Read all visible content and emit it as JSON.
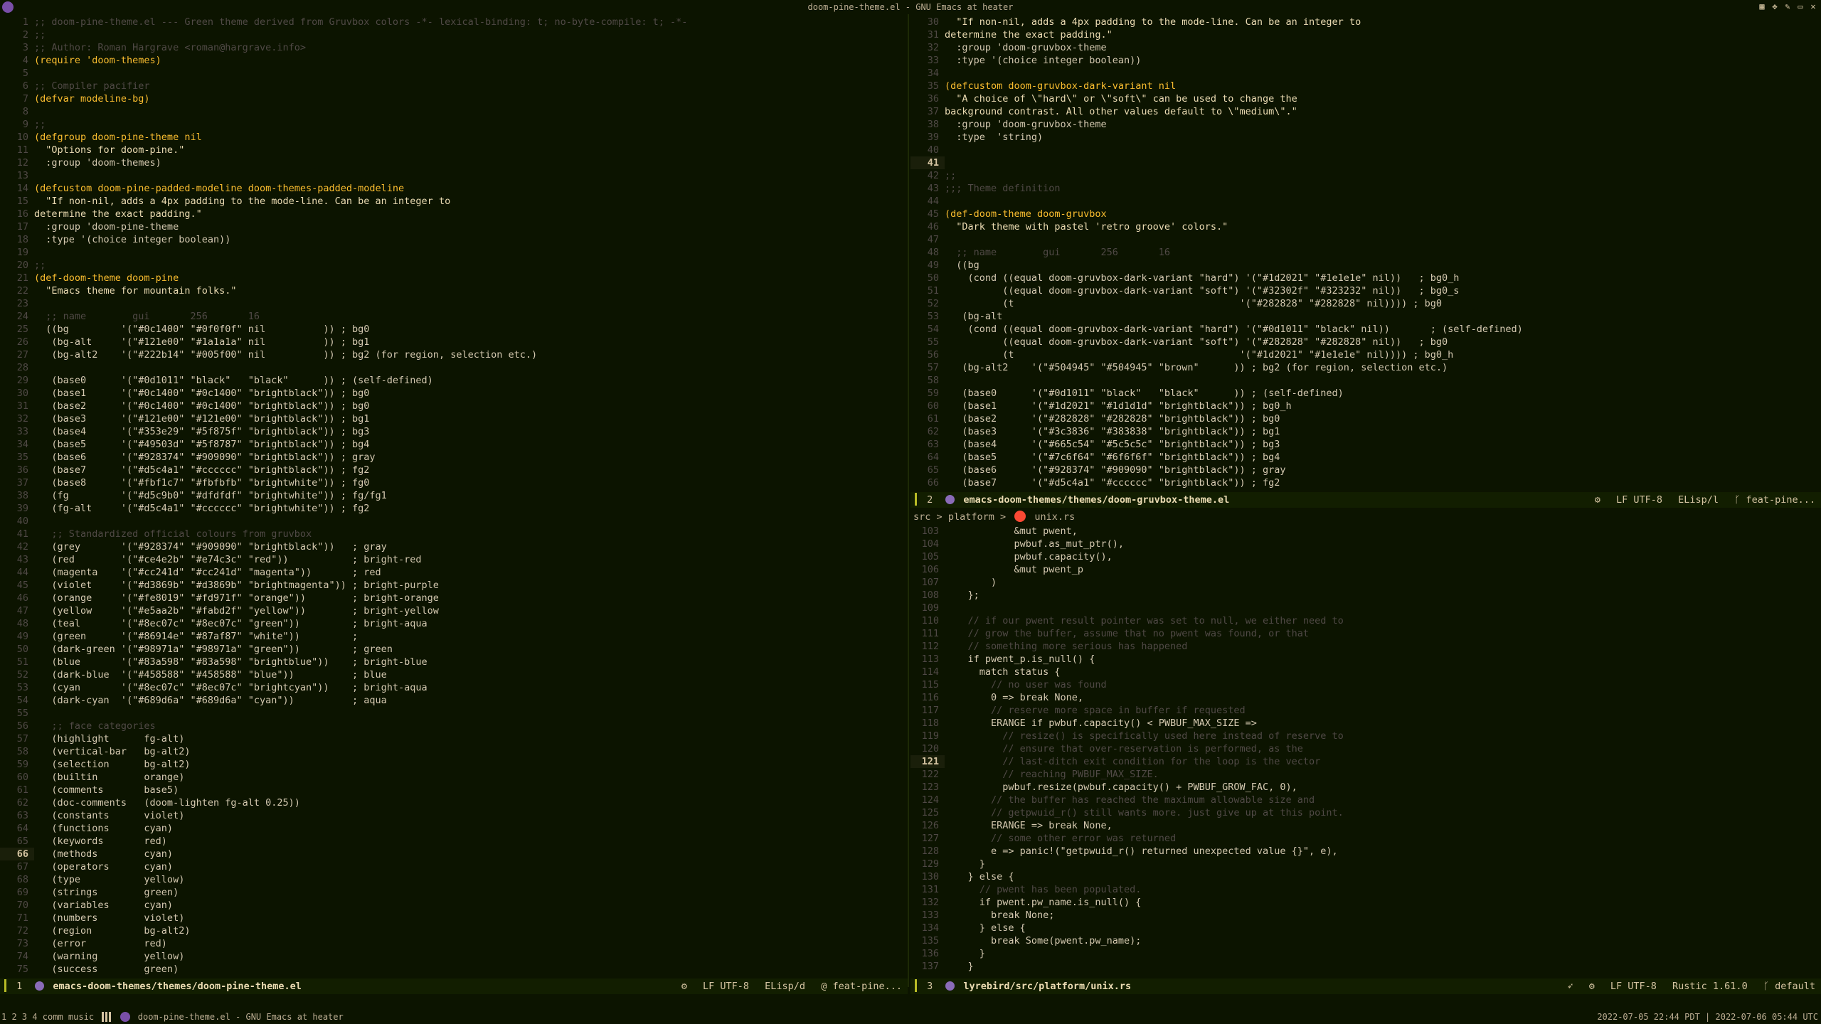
{
  "window": {
    "title": "doom-pine-theme.el - GNU Emacs at heater",
    "icons": [
      "emacs-icon",
      "tile-icon",
      "move-icon",
      "pin-icon",
      "maximize-icon",
      "close-icon"
    ]
  },
  "pane_left": {
    "lines": [
      {
        "n": "1",
        "t": ";; doom-pine-theme.el --- Green theme derived from Gruvbox colors -*- lexical-binding: t; no-byte-compile: t; -*-"
      },
      {
        "n": "2",
        "t": ";;"
      },
      {
        "n": "3",
        "t": ";; Author: Roman Hargrave <roman@hargrave.info>"
      },
      {
        "n": "4",
        "t": "(require 'doom-themes)"
      },
      {
        "n": "5",
        "t": ""
      },
      {
        "n": "6",
        "t": ";; Compiler pacifier"
      },
      {
        "n": "7",
        "t": "(defvar modeline-bg)"
      },
      {
        "n": "8",
        "t": ""
      },
      {
        "n": "9",
        "t": ";;"
      },
      {
        "n": "10",
        "t": "(defgroup doom-pine-theme nil"
      },
      {
        "n": "11",
        "t": "  \"Options for doom-pine.\""
      },
      {
        "n": "12",
        "t": "  :group 'doom-themes)"
      },
      {
        "n": "13",
        "t": ""
      },
      {
        "n": "14",
        "t": "(defcustom doom-pine-padded-modeline doom-themes-padded-modeline"
      },
      {
        "n": "15",
        "t": "  \"If non-nil, adds a 4px padding to the mode-line. Can be an integer to"
      },
      {
        "n": "16",
        "t": "determine the exact padding.\""
      },
      {
        "n": "17",
        "t": "  :group 'doom-pine-theme"
      },
      {
        "n": "18",
        "t": "  :type '(choice integer boolean))"
      },
      {
        "n": "19",
        "t": ""
      },
      {
        "n": "20",
        "t": ";;"
      },
      {
        "n": "21",
        "t": "(def-doom-theme doom-pine"
      },
      {
        "n": "22",
        "t": "  \"Emacs theme for mountain folks.\""
      },
      {
        "n": "23",
        "t": ""
      },
      {
        "n": "24",
        "t": "  ;; name        gui       256       16"
      },
      {
        "n": "25",
        "t": "  ((bg         '(\"#0c1400\" \"#0f0f0f\" nil          )) ; bg0"
      },
      {
        "n": "26",
        "t": "   (bg-alt     '(\"#121e00\" \"#1a1a1a\" nil          )) ; bg1"
      },
      {
        "n": "27",
        "t": "   (bg-alt2    '(\"#222b14\" \"#005f00\" nil          )) ; bg2 (for region, selection etc.)"
      },
      {
        "n": "28",
        "t": ""
      },
      {
        "n": "29",
        "t": "   (base0      '(\"#0d1011\" \"black\"   \"black\"      )) ; (self-defined)"
      },
      {
        "n": "30",
        "t": "   (base1      '(\"#0c1400\" \"#0c1400\" \"brightblack\")) ; bg0"
      },
      {
        "n": "31",
        "t": "   (base2      '(\"#0c1400\" \"#0c1400\" \"brightblack\")) ; bg0"
      },
      {
        "n": "32",
        "t": "   (base3      '(\"#121e00\" \"#121e00\" \"brightblack\")) ; bg1"
      },
      {
        "n": "33",
        "t": "   (base4      '(\"#353e29\" \"#5f875f\" \"brightblack\")) ; bg3"
      },
      {
        "n": "34",
        "t": "   (base5      '(\"#49503d\" \"#5f8787\" \"brightblack\")) ; bg4"
      },
      {
        "n": "35",
        "t": "   (base6      '(\"#928374\" \"#909090\" \"brightblack\")) ; gray"
      },
      {
        "n": "36",
        "t": "   (base7      '(\"#d5c4a1\" \"#cccccc\" \"brightblack\")) ; fg2"
      },
      {
        "n": "37",
        "t": "   (base8      '(\"#fbf1c7\" \"#fbfbfb\" \"brightwhite\")) ; fg0"
      },
      {
        "n": "38",
        "t": "   (fg         '(\"#d5c9b0\" \"#dfdfdf\" \"brightwhite\")) ; fg/fg1"
      },
      {
        "n": "39",
        "t": "   (fg-alt     '(\"#d5c4a1\" \"#cccccc\" \"brightwhite\")) ; fg2"
      },
      {
        "n": "40",
        "t": ""
      },
      {
        "n": "41",
        "t": "   ;; Standardized official colours from gruvbox"
      },
      {
        "n": "42",
        "t": "   (grey       '(\"#928374\" \"#909090\" \"brightblack\"))   ; gray"
      },
      {
        "n": "43",
        "t": "   (red        '(\"#ce4e2b\" \"#e74c3c\" \"red\"))           ; bright-red"
      },
      {
        "n": "44",
        "t": "   (magenta    '(\"#cc241d\" \"#cc241d\" \"magenta\"))       ; red"
      },
      {
        "n": "45",
        "t": "   (violet     '(\"#d3869b\" \"#d3869b\" \"brightmagenta\")) ; bright-purple"
      },
      {
        "n": "46",
        "t": "   (orange     '(\"#fe8019\" \"#fd971f\" \"orange\"))        ; bright-orange"
      },
      {
        "n": "47",
        "t": "   (yellow     '(\"#e5aa2b\" \"#fabd2f\" \"yellow\"))        ; bright-yellow"
      },
      {
        "n": "48",
        "t": "   (teal       '(\"#8ec07c\" \"#8ec07c\" \"green\"))         ; bright-aqua"
      },
      {
        "n": "49",
        "t": "   (green      '(\"#86914e\" \"#87af87\" \"white\"))         ;"
      },
      {
        "n": "50",
        "t": "   (dark-green '(\"#98971a\" \"#98971a\" \"green\"))         ; green"
      },
      {
        "n": "51",
        "t": "   (blue       '(\"#83a598\" \"#83a598\" \"brightblue\"))    ; bright-blue"
      },
      {
        "n": "52",
        "t": "   (dark-blue  '(\"#458588\" \"#458588\" \"blue\"))          ; blue"
      },
      {
        "n": "53",
        "t": "   (cyan       '(\"#8ec07c\" \"#8ec07c\" \"brightcyan\"))    ; bright-aqua"
      },
      {
        "n": "54",
        "t": "   (dark-cyan  '(\"#689d6a\" \"#689d6a\" \"cyan\"))          ; aqua"
      },
      {
        "n": "55",
        "t": ""
      },
      {
        "n": "56",
        "t": "   ;; face categories"
      },
      {
        "n": "57",
        "t": "   (highlight      fg-alt)"
      },
      {
        "n": "58",
        "t": "   (vertical-bar   bg-alt2)"
      },
      {
        "n": "59",
        "t": "   (selection      bg-alt2)"
      },
      {
        "n": "60",
        "t": "   (builtin        orange)"
      },
      {
        "n": "61",
        "t": "   (comments       base5)"
      },
      {
        "n": "62",
        "t": "   (doc-comments   (doom-lighten fg-alt 0.25))"
      },
      {
        "n": "63",
        "t": "   (constants      violet)"
      },
      {
        "n": "64",
        "t": "   (functions      cyan)"
      },
      {
        "n": "65",
        "t": "   (keywords       red)"
      },
      {
        "n": "66",
        "t": "   (methods        cyan)",
        "cur": true
      },
      {
        "n": "67",
        "t": "   (operators      cyan)"
      },
      {
        "n": "68",
        "t": "   (type           yellow)"
      },
      {
        "n": "69",
        "t": "   (strings        green)"
      },
      {
        "n": "70",
        "t": "   (variables      cyan)"
      },
      {
        "n": "71",
        "t": "   (numbers        violet)"
      },
      {
        "n": "72",
        "t": "   (region         bg-alt2)"
      },
      {
        "n": "73",
        "t": "   (error          red)"
      },
      {
        "n": "74",
        "t": "   (warning        yellow)"
      },
      {
        "n": "75",
        "t": "   (success        green)"
      }
    ]
  },
  "pane_right_top": {
    "lines": [
      {
        "n": "30",
        "t": "  \"If non-nil, adds a 4px padding to the mode-line. Can be an integer to"
      },
      {
        "n": "31",
        "t": "determine the exact padding.\""
      },
      {
        "n": "32",
        "t": "  :group 'doom-gruvbox-theme"
      },
      {
        "n": "33",
        "t": "  :type '(choice integer boolean))"
      },
      {
        "n": "34",
        "t": ""
      },
      {
        "n": "35",
        "t": "(defcustom doom-gruvbox-dark-variant nil"
      },
      {
        "n": "36",
        "t": "  \"A choice of \\\"hard\\\" or \\\"soft\\\" can be used to change the"
      },
      {
        "n": "37",
        "t": "background contrast. All other values default to \\\"medium\\\".\""
      },
      {
        "n": "38",
        "t": "  :group 'doom-gruvbox-theme"
      },
      {
        "n": "39",
        "t": "  :type  'string)"
      },
      {
        "n": "40",
        "t": ""
      },
      {
        "n": "41",
        "t": "",
        "cur": true
      },
      {
        "n": "42",
        "t": ";;"
      },
      {
        "n": "43",
        "t": ";;; Theme definition"
      },
      {
        "n": "44",
        "t": ""
      },
      {
        "n": "45",
        "t": "(def-doom-theme doom-gruvbox"
      },
      {
        "n": "46",
        "t": "  \"Dark theme with pastel 'retro groove' colors.\""
      },
      {
        "n": "47",
        "t": ""
      },
      {
        "n": "48",
        "t": "  ;; name        gui       256       16"
      },
      {
        "n": "49",
        "t": "  ((bg"
      },
      {
        "n": "50",
        "t": "    (cond ((equal doom-gruvbox-dark-variant \"hard\") '(\"#1d2021\" \"#1e1e1e\" nil))   ; bg0_h"
      },
      {
        "n": "51",
        "t": "          ((equal doom-gruvbox-dark-variant \"soft\") '(\"#32302f\" \"#323232\" nil))   ; bg0_s"
      },
      {
        "n": "52",
        "t": "          (t                                       '(\"#282828\" \"#282828\" nil)))) ; bg0"
      },
      {
        "n": "53",
        "t": "   (bg-alt"
      },
      {
        "n": "54",
        "t": "    (cond ((equal doom-gruvbox-dark-variant \"hard\") '(\"#0d1011\" \"black\" nil))       ; (self-defined)"
      },
      {
        "n": "55",
        "t": "          ((equal doom-gruvbox-dark-variant \"soft\") '(\"#282828\" \"#282828\" nil))   ; bg0"
      },
      {
        "n": "56",
        "t": "          (t                                       '(\"#1d2021\" \"#1e1e1e\" nil)))) ; bg0_h"
      },
      {
        "n": "57",
        "t": "   (bg-alt2    '(\"#504945\" \"#504945\" \"brown\"      )) ; bg2 (for region, selection etc.)"
      },
      {
        "n": "58",
        "t": ""
      },
      {
        "n": "59",
        "t": "   (base0      '(\"#0d1011\" \"black\"   \"black\"      )) ; (self-defined)"
      },
      {
        "n": "60",
        "t": "   (base1      '(\"#1d2021\" \"#1d1d1d\" \"brightblack\")) ; bg0_h"
      },
      {
        "n": "61",
        "t": "   (base2      '(\"#282828\" \"#282828\" \"brightblack\")) ; bg0"
      },
      {
        "n": "62",
        "t": "   (base3      '(\"#3c3836\" \"#383838\" \"brightblack\")) ; bg1"
      },
      {
        "n": "63",
        "t": "   (base4      '(\"#665c54\" \"#5c5c5c\" \"brightblack\")) ; bg3"
      },
      {
        "n": "64",
        "t": "   (base5      '(\"#7c6f64\" \"#6f6f6f\" \"brightblack\")) ; bg4"
      },
      {
        "n": "65",
        "t": "   (base6      '(\"#928374\" \"#909090\" \"brightblack\")) ; gray"
      },
      {
        "n": "66",
        "t": "   (base7      '(\"#d5c4a1\" \"#cccccc\" \"brightblack\")) ; fg2"
      }
    ]
  },
  "pane_right_bottom": {
    "breadcrumb": {
      "part1": "src",
      "sep": ">",
      "part2": "platform",
      "sep2": ">",
      "file": "unix.rs"
    },
    "lines": [
      {
        "n": "103",
        "t": "            &mut pwent,"
      },
      {
        "n": "104",
        "t": "            pwbuf.as_mut_ptr(),"
      },
      {
        "n": "105",
        "t": "            pwbuf.capacity(),"
      },
      {
        "n": "106",
        "t": "            &mut pwent_p"
      },
      {
        "n": "107",
        "t": "        )"
      },
      {
        "n": "108",
        "t": "    };"
      },
      {
        "n": "109",
        "t": ""
      },
      {
        "n": "110",
        "t": "    // if our pwent result pointer was set to null, we either need to"
      },
      {
        "n": "111",
        "t": "    // grow the buffer, assume that no pwent was found, or that"
      },
      {
        "n": "112",
        "t": "    // something more serious has happened"
      },
      {
        "n": "113",
        "t": "    if pwent_p.is_null() {"
      },
      {
        "n": "114",
        "t": "      match status {"
      },
      {
        "n": "115",
        "t": "        // no user was found"
      },
      {
        "n": "116",
        "t": "        0 => break None,"
      },
      {
        "n": "117",
        "t": "        // reserve more space in buffer if requested"
      },
      {
        "n": "118",
        "t": "        ERANGE if pwbuf.capacity() < PWBUF_MAX_SIZE =>"
      },
      {
        "n": "119",
        "t": "          // resize() is specifically used here instead of reserve to"
      },
      {
        "n": "120",
        "t": "          // ensure that over-reservation is performed, as the"
      },
      {
        "n": "121",
        "t": "          // last-ditch exit condition for the loop is the vector",
        "cur": true
      },
      {
        "n": "122",
        "t": "          // reaching PWBUF_MAX_SIZE."
      },
      {
        "n": "123",
        "t": "          pwbuf.resize(pwbuf.capacity() + PWBUF_GROW_FAC, 0),"
      },
      {
        "n": "124",
        "t": "        // the buffer has reached the maximum allowable size and"
      },
      {
        "n": "125",
        "t": "        // getpwuid_r() still wants more. just give up at this point."
      },
      {
        "n": "126",
        "t": "        ERANGE => break None,"
      },
      {
        "n": "127",
        "t": "        // some other error was returned"
      },
      {
        "n": "128",
        "t": "        e => panic!(\"getpwuid_r() returned unexpected value {}\", e),"
      },
      {
        "n": "129",
        "t": "      }"
      },
      {
        "n": "130",
        "t": "    } else {"
      },
      {
        "n": "131",
        "t": "      // pwent has been populated."
      },
      {
        "n": "132",
        "t": "      if pwent.pw_name.is_null() {"
      },
      {
        "n": "133",
        "t": "        break None;"
      },
      {
        "n": "134",
        "t": "      } else {"
      },
      {
        "n": "135",
        "t": "        break Some(pwent.pw_name);"
      },
      {
        "n": "136",
        "t": "      }"
      },
      {
        "n": "137",
        "t": "    }"
      }
    ]
  },
  "modelines": {
    "left": {
      "num": "1",
      "file": "emacs-doom-themes/themes/doom-pine-theme.el",
      "eol": "LF UTF-8",
      "mode": "ELisp/d",
      "branch": "@ feat-pine..."
    },
    "right_top": {
      "num": "2",
      "file": "emacs-doom-themes/themes/doom-gruvbox-theme.el",
      "eol": "LF UTF-8",
      "mode": "ELisp/l",
      "branch": "feat-pine..."
    },
    "right_bottom": {
      "num": "3",
      "file": "lyrebird/src/platform/unix.rs",
      "eol": "LF UTF-8",
      "mode": "Rustic 1.61.0",
      "branch": "default"
    }
  },
  "taskbar": {
    "workspaces": "1 2 3 4 comm music",
    "window": "doom-pine-theme.el - GNU Emacs at heater",
    "clock_local": "2022-07-05 22:44 PDT",
    "clock_utc": "2022-07-06 05:44 UTC"
  },
  "colors": {
    "accent": "#b8bb26",
    "bg": "#0c1400",
    "fg": "#d5c9b0"
  }
}
